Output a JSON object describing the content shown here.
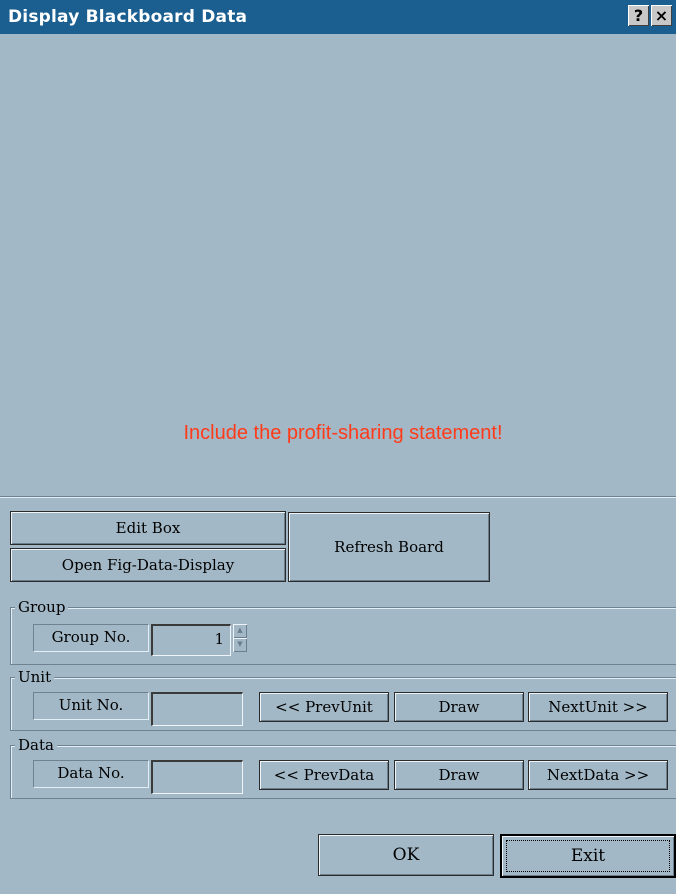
{
  "window": {
    "title": "Display Blackboard Data",
    "help_glyph": "?",
    "close_glyph": "×"
  },
  "board": {
    "message": "Include the profit-sharing statement!",
    "message_color": "#ff3b1a"
  },
  "buttons": {
    "edit_box": "Edit Box",
    "open_fig": "Open Fig-Data-Display",
    "refresh": "Refresh Board",
    "ok": "OK",
    "exit": "Exit"
  },
  "group": {
    "title": "Group",
    "label": "Group No.",
    "value": "1"
  },
  "unit": {
    "title": "Unit",
    "label": "Unit No.",
    "value": "",
    "prev": "<< PrevUnit",
    "draw": "Draw",
    "next": "NextUnit >>"
  },
  "data": {
    "title": "Data",
    "label": "Data No.",
    "value": "",
    "prev": "<< PrevData",
    "draw": "Draw",
    "next": "NextData >>"
  },
  "colors": {
    "titlebar": "#1a5f90",
    "face": "#a2b8c6"
  }
}
